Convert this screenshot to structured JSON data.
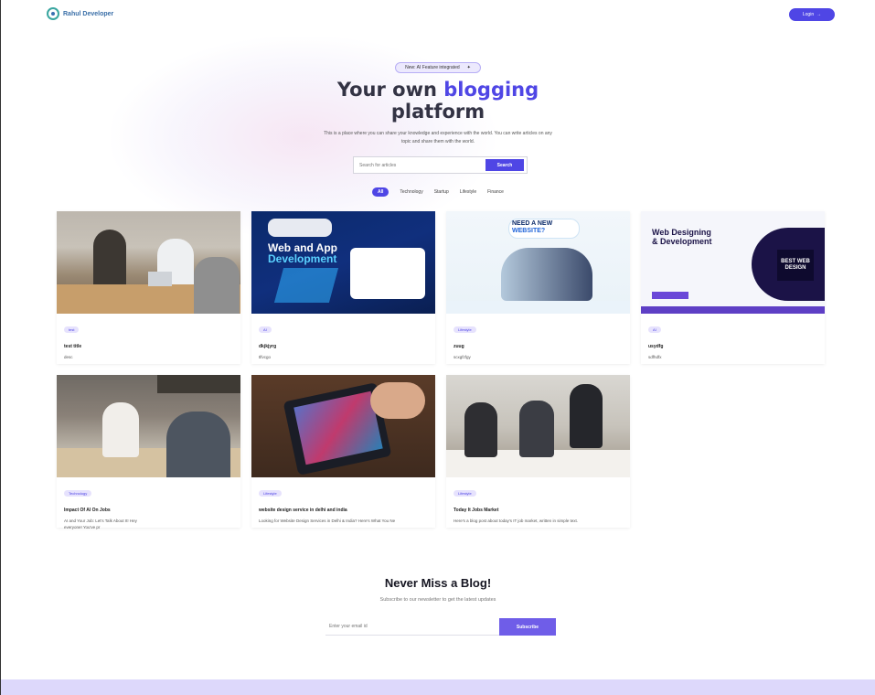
{
  "brand": {
    "name": "Rahul Developer"
  },
  "header": {
    "login_label": "Login",
    "login_arrow": "→"
  },
  "hero": {
    "badge_text": "New: AI Feature integrated",
    "badge_icon": "✦",
    "title_prefix": "Your own",
    "title_accent": "blogging",
    "title_suffix": "platform",
    "description": "This is a place where you can share your knowledge and experience with the world. You can write articles on any topic and share them with the world."
  },
  "search": {
    "placeholder": "Search for articles",
    "button_label": "Search"
  },
  "filters": [
    "All",
    "Technology",
    "Startup",
    "Lifestyle",
    "Finance"
  ],
  "posts": [
    {
      "tag": "test",
      "title": "test title",
      "desc": "desc"
    },
    {
      "tag": "AI",
      "title": "dkjkjyrg",
      "desc": "tlfvcgo"
    },
    {
      "tag": "Lifestyle",
      "title": "zuug",
      "desc": "scxgfzfgy"
    },
    {
      "tag": "AI",
      "title": "usydfg",
      "desc": "sdfhdfx"
    },
    {
      "tag": "Technology",
      "title": "Impact Of AI On Jobs",
      "desc": "AI and Your Job: Let's Talk About It! Hey everyone! You've pr"
    },
    {
      "tag": "Lifestyle",
      "title": "website design service in delhi and india",
      "desc": "Looking for Website Design Services in Delhi & India? Here's What You Ne"
    },
    {
      "tag": "Lifestyle",
      "title": "Today It Jobs Market",
      "desc": "Here's a blog post about today's IT job market, written in simple text."
    }
  ],
  "images": {
    "webapp_title_1": "Web and App",
    "webapp_title_2": "Development",
    "newsite_1": "NEED A NEW",
    "newsite_2": "WEBSITE?",
    "webdesign_1": "Web Designing",
    "webdesign_2": "& Development",
    "webdesign_best": "BEST WEB DESIGN"
  },
  "newsletter": {
    "title": "Never Miss a Blog!",
    "subtitle": "Subscribe to our newsletter to get the latest updates",
    "email_placeholder": "Enter your email id",
    "button_label": "Subscribe"
  },
  "colors": {
    "accent": "#4f46e5",
    "tag_bg": "#e6e2fd",
    "footer_band": "#ddd8fb"
  }
}
